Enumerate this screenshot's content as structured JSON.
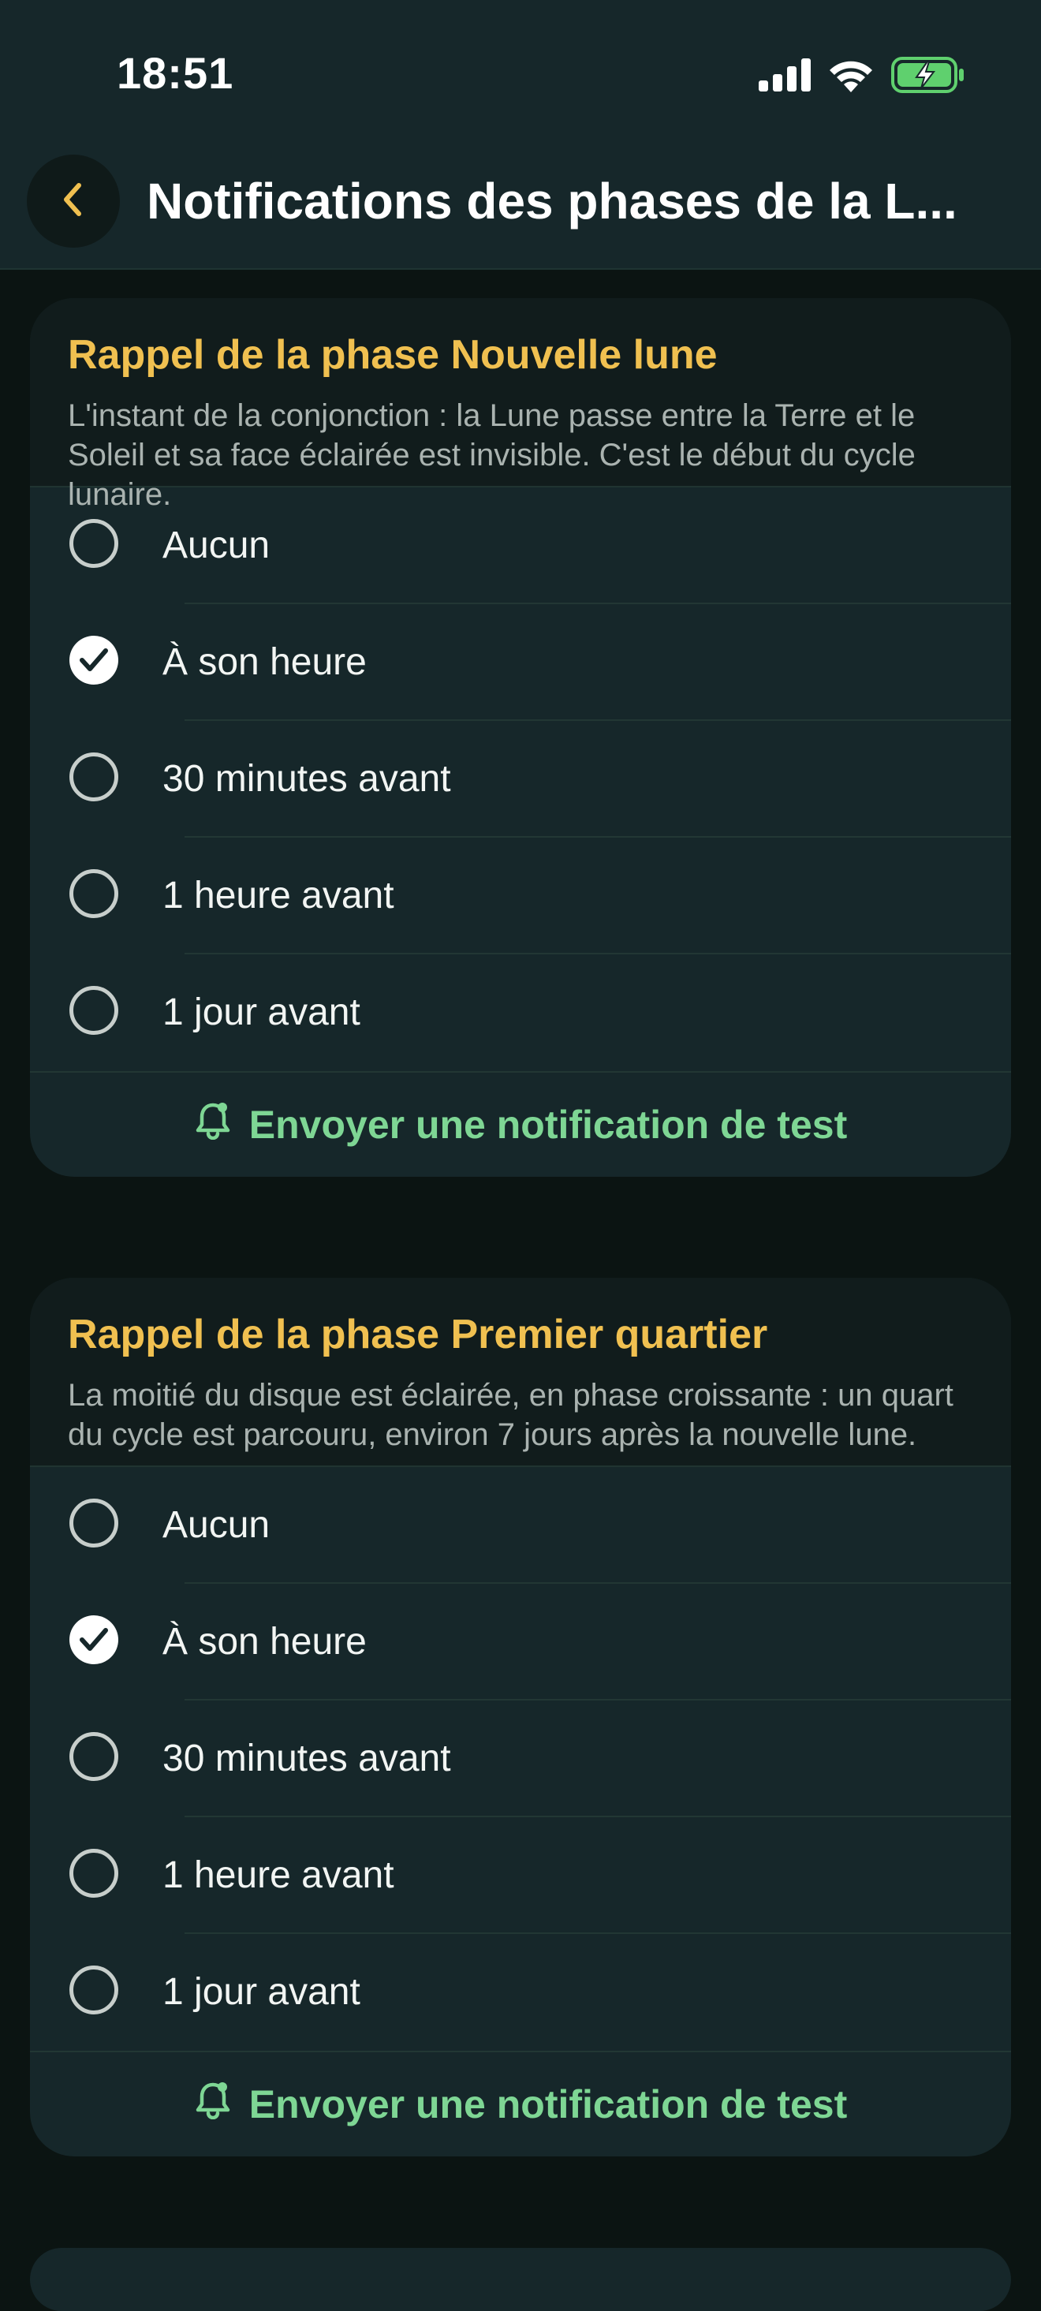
{
  "status_bar": {
    "time": "18:51",
    "icons": [
      "cellular-signal-icon",
      "wifi-icon",
      "battery-charging-icon"
    ]
  },
  "header": {
    "back_icon": "chevron-left-icon",
    "title": "Notifications des phases de la L..."
  },
  "colors": {
    "accent_title": "#f0c050",
    "accent_button": "#7ed694",
    "background": "#0b1412",
    "card": "#16272a"
  },
  "sections": [
    {
      "title": "Rappel de la phase Nouvelle lune",
      "description": "L'instant de la conjonction : la Lune passe entre la Terre et le Soleil et sa face éclairée est invisible. C'est le début du cycle lunaire.",
      "options": [
        {
          "label": "Aucun",
          "selected": false
        },
        {
          "label": "À son heure",
          "selected": true
        },
        {
          "label": "30 minutes avant",
          "selected": false
        },
        {
          "label": "1 heure avant",
          "selected": false
        },
        {
          "label": "1 jour avant",
          "selected": false
        }
      ],
      "test_button_label": "Envoyer une notification de test",
      "test_button_icon": "bell-icon"
    },
    {
      "title": "Rappel de la phase Premier quartier",
      "description": "La moitié du disque est éclairée, en phase croissante : un quart du cycle est parcouru, environ 7 jours après la nouvelle lune.",
      "options": [
        {
          "label": "Aucun",
          "selected": false
        },
        {
          "label": "À son heure",
          "selected": true
        },
        {
          "label": "30 minutes avant",
          "selected": false
        },
        {
          "label": "1 heure avant",
          "selected": false
        },
        {
          "label": "1 jour avant",
          "selected": false
        }
      ],
      "test_button_label": "Envoyer une notification de test",
      "test_button_icon": "bell-icon"
    }
  ]
}
